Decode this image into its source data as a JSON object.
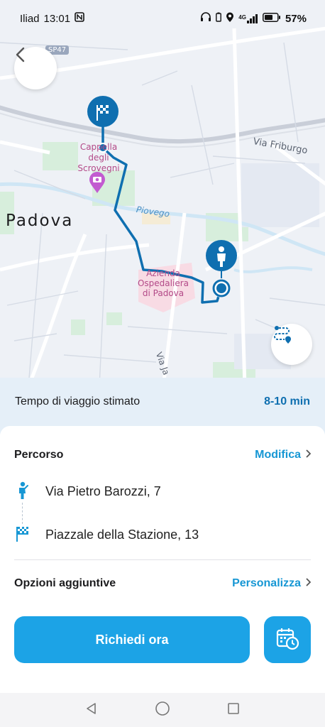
{
  "status": {
    "carrier": "Iliad",
    "time": "13:01",
    "network": "4G",
    "battery": "57%"
  },
  "map": {
    "labels": {
      "city": "Padova",
      "road_sp47": "SP47",
      "via_friburgo": "Via Friburgo",
      "piovego": "Piovego",
      "cappella_1": "Cappella",
      "cappella_2": "degli",
      "cappella_3": "Scrovegni",
      "azienda_1": "Azienda",
      "azienda_2": "Ospedaliera",
      "azienda_3": "di Padova",
      "via_ja": "Via Ja"
    },
    "route_color": "#0f6fb0"
  },
  "eta": {
    "label": "Tempo di viaggio stimato",
    "value": "8-10 min"
  },
  "route": {
    "title": "Percorso",
    "edit": "Modifica",
    "origin": "Via Pietro Barozzi, 7",
    "destination": "Piazzale della Stazione, 13"
  },
  "options": {
    "title": "Opzioni aggiuntive",
    "customize": "Personalizza"
  },
  "actions": {
    "request_now": "Richiedi ora"
  },
  "colors": {
    "accent": "#1ca3e6",
    "link": "#1797d4",
    "eta_bg": "#e5eff8"
  }
}
